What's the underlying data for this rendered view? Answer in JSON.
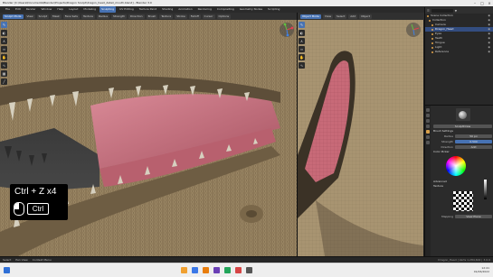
{
  "window": {
    "title": "Blender [C:\\Users\\Documents\\Blender\\Projects\\Dragon Sculpt\\dragon_head_detail_mouth.blend] - Blender 3.0"
  },
  "menubar": {
    "items": [
      "File",
      "Edit",
      "Render",
      "Window",
      "Help",
      "Layout",
      "Modeling",
      "Sculpting",
      "UV Editing",
      "Texture Paint",
      "Shading",
      "Animation",
      "Rendering",
      "Compositing",
      "Geometry Nodes",
      "Scripting"
    ],
    "active_index": 7
  },
  "left_header": {
    "items": [
      "Sculpt Mode",
      "View",
      "Sculpt",
      "Mask",
      "Face Sets",
      "Texture",
      "Radius",
      "Strength",
      "Direction",
      "Brush",
      "Texture",
      "Stroke",
      "Falloff",
      "Cursor",
      "Options"
    ]
  },
  "right_header": {
    "items": [
      "Object Mode",
      "View",
      "Select",
      "Add",
      "Object"
    ]
  },
  "tools": {
    "left": [
      "draw-icon",
      "clay-icon",
      "crease-icon",
      "smooth-icon",
      "grab-icon",
      "snake-hook-icon",
      "mask-icon",
      "line-icon"
    ],
    "right": [
      "select-icon",
      "cursor-icon",
      "move-icon",
      "rotate-icon",
      "scale-icon",
      "transform-icon"
    ]
  },
  "key_overlay": {
    "combo": "Ctrl + Z x4",
    "key": "Ctrl"
  },
  "outliner": {
    "items": [
      {
        "label": "Scene Collection",
        "selected": false
      },
      {
        "label": "Collection",
        "selected": false
      },
      {
        "label": "Camera",
        "selected": false
      },
      {
        "label": "Dragon_Head",
        "selected": true
      },
      {
        "label": "Eyes",
        "selected": false
      },
      {
        "label": "Teeth",
        "selected": false
      },
      {
        "label": "Tongue",
        "selected": false
      },
      {
        "label": "Light",
        "selected": false
      },
      {
        "label": "Reference",
        "selected": false
      }
    ]
  },
  "properties": {
    "brush_name": "SculptDraw",
    "brush_settings_label": "Brush Settings",
    "fields": [
      {
        "label": "Radius",
        "value": "50 px"
      },
      {
        "label": "Strength",
        "value": "0.500"
      },
      {
        "label": "Direction",
        "value": "Add"
      }
    ],
    "color_picker_label": "Color Picker",
    "advanced_label": "Advanced",
    "texture_label": "Texture",
    "mapping_label": "Mapping",
    "mapping_value": "View Plane"
  },
  "statusbar": {
    "items": [
      "Select",
      "Pan View",
      "Context Menu"
    ],
    "version": "Dragon_Head | Verts 1,284,602 | 3.0.0"
  },
  "taskbar": {
    "time": "12:41",
    "date": "01/06/2022"
  },
  "colors": {
    "accent": "#4772b3",
    "skin": "#8a7657",
    "mouth_pink": "#c86a78",
    "teeth": "#d6d0bf"
  }
}
